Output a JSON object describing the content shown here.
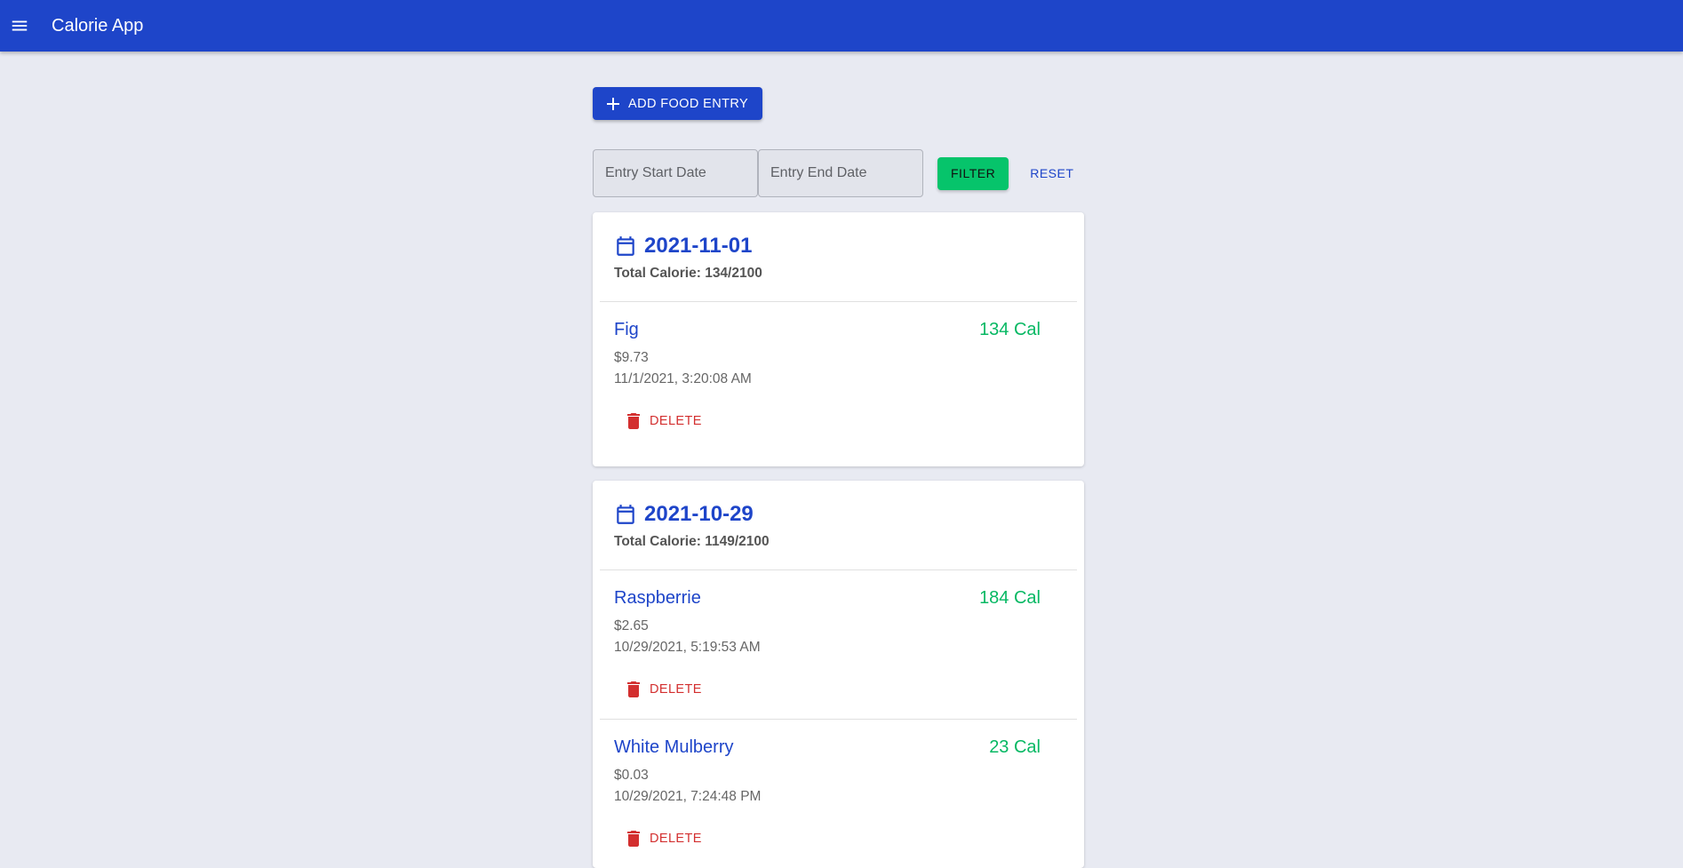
{
  "app": {
    "title": "Calorie App"
  },
  "toolbar": {
    "add_label": "ADD FOOD ENTRY"
  },
  "filter": {
    "start_placeholder": "Entry Start Date",
    "end_placeholder": "Entry End Date",
    "filter_label": "FILTER",
    "reset_label": "RESET"
  },
  "days": [
    {
      "date": "2021-11-01",
      "total": "Total Calorie: 134/2100",
      "entries": [
        {
          "name": "Fig",
          "calories": "134 Cal",
          "price": "$9.73",
          "time": "11/1/2021, 3:20:08 AM",
          "delete_label": "DELETE"
        }
      ]
    },
    {
      "date": "2021-10-29",
      "total": "Total Calorie: 1149/2100",
      "entries": [
        {
          "name": "Raspberrie",
          "calories": "184 Cal",
          "price": "$2.65",
          "time": "10/29/2021, 5:19:53 AM",
          "delete_label": "DELETE"
        },
        {
          "name": "White Mulberry",
          "calories": "23 Cal",
          "price": "$0.03",
          "time": "10/29/2021, 7:24:48 PM",
          "delete_label": "DELETE"
        }
      ]
    }
  ],
  "colors": {
    "primary": "#1e45c9",
    "success": "#06c46b",
    "danger": "#d32f2f",
    "background": "#e8eaf2"
  }
}
